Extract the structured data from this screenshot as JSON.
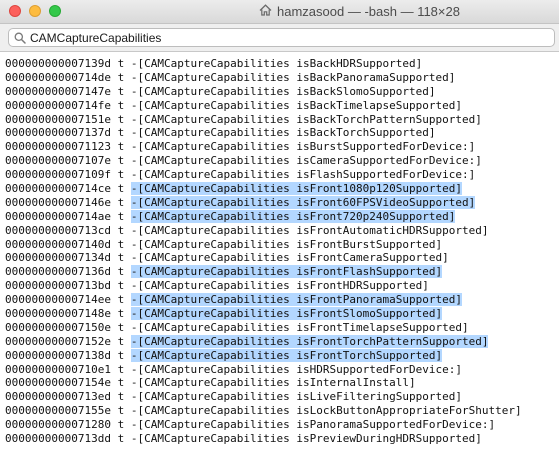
{
  "window": {
    "title": "hamzasood — -bash — 118×28",
    "home_icon": "house-icon"
  },
  "find_bar": {
    "query": "CAMCaptureCapabilities",
    "icon": "search-icon"
  },
  "colors": {
    "highlight": "#b3d7ff",
    "text": "#111111"
  },
  "terminal": {
    "lines": [
      {
        "address": "000000000007139d",
        "type": "t",
        "text": "-[CAMCaptureCapabilities isBackHDRSupported]",
        "highlighted": false
      },
      {
        "address": "00000000000714de",
        "type": "t",
        "text": "-[CAMCaptureCapabilities isBackPanoramaSupported]",
        "highlighted": false
      },
      {
        "address": "000000000007147e",
        "type": "t",
        "text": "-[CAMCaptureCapabilities isBackSlomoSupported]",
        "highlighted": false
      },
      {
        "address": "00000000000714fe",
        "type": "t",
        "text": "-[CAMCaptureCapabilities isBackTimelapseSupported]",
        "highlighted": false
      },
      {
        "address": "000000000007151e",
        "type": "t",
        "text": "-[CAMCaptureCapabilities isBackTorchPatternSupported]",
        "highlighted": false
      },
      {
        "address": "000000000007137d",
        "type": "t",
        "text": "-[CAMCaptureCapabilities isBackTorchSupported]",
        "highlighted": false
      },
      {
        "address": "0000000000071123",
        "type": "t",
        "text": "-[CAMCaptureCapabilities isBurstSupportedForDevice:]",
        "highlighted": false
      },
      {
        "address": "000000000007107e",
        "type": "t",
        "text": "-[CAMCaptureCapabilities isCameraSupportedForDevice:]",
        "highlighted": false
      },
      {
        "address": "000000000007109f",
        "type": "t",
        "text": "-[CAMCaptureCapabilities isFlashSupportedForDevice:]",
        "highlighted": false
      },
      {
        "address": "00000000000714ce",
        "type": "t",
        "text": "-[CAMCaptureCapabilities isFront1080p120Supported]",
        "highlighted": true
      },
      {
        "address": "000000000007146e",
        "type": "t",
        "text": "-[CAMCaptureCapabilities isFront60FPSVideoSupported]",
        "highlighted": true
      },
      {
        "address": "00000000000714ae",
        "type": "t",
        "text": "-[CAMCaptureCapabilities isFront720p240Supported]",
        "highlighted": true
      },
      {
        "address": "00000000000713cd",
        "type": "t",
        "text": "-[CAMCaptureCapabilities isFrontAutomaticHDRSupported]",
        "highlighted": false
      },
      {
        "address": "000000000007140d",
        "type": "t",
        "text": "-[CAMCaptureCapabilities isFrontBurstSupported]",
        "highlighted": false
      },
      {
        "address": "000000000007134d",
        "type": "t",
        "text": "-[CAMCaptureCapabilities isFrontCameraSupported]",
        "highlighted": false
      },
      {
        "address": "000000000007136d",
        "type": "t",
        "text": "-[CAMCaptureCapabilities isFrontFlashSupported]",
        "highlighted": true
      },
      {
        "address": "00000000000713bd",
        "type": "t",
        "text": "-[CAMCaptureCapabilities isFrontHDRSupported]",
        "highlighted": false
      },
      {
        "address": "00000000000714ee",
        "type": "t",
        "text": "-[CAMCaptureCapabilities isFrontPanoramaSupported]",
        "highlighted": true
      },
      {
        "address": "000000000007148e",
        "type": "t",
        "text": "-[CAMCaptureCapabilities isFrontSlomoSupported]",
        "highlighted": true
      },
      {
        "address": "000000000007150e",
        "type": "t",
        "text": "-[CAMCaptureCapabilities isFrontTimelapseSupported]",
        "highlighted": false
      },
      {
        "address": "000000000007152e",
        "type": "t",
        "text": "-[CAMCaptureCapabilities isFrontTorchPatternSupported]",
        "highlighted": true
      },
      {
        "address": "000000000007138d",
        "type": "t",
        "text": "-[CAMCaptureCapabilities isFrontTorchSupported]",
        "highlighted": true
      },
      {
        "address": "00000000000710e1",
        "type": "t",
        "text": "-[CAMCaptureCapabilities isHDRSupportedForDevice:]",
        "highlighted": false
      },
      {
        "address": "000000000007154e",
        "type": "t",
        "text": "-[CAMCaptureCapabilities isInternalInstall]",
        "highlighted": false
      },
      {
        "address": "00000000000713ed",
        "type": "t",
        "text": "-[CAMCaptureCapabilities isLiveFilteringSupported]",
        "highlighted": false
      },
      {
        "address": "000000000007155e",
        "type": "t",
        "text": "-[CAMCaptureCapabilities isLockButtonAppropriateForShutter]",
        "highlighted": false
      },
      {
        "address": "0000000000071280",
        "type": "t",
        "text": "-[CAMCaptureCapabilities isPanoramaSupportedForDevice:]",
        "highlighted": false
      },
      {
        "address": "00000000000713dd",
        "type": "t",
        "text": "-[CAMCaptureCapabilities isPreviewDuringHDRSupported]",
        "highlighted": false
      }
    ]
  }
}
